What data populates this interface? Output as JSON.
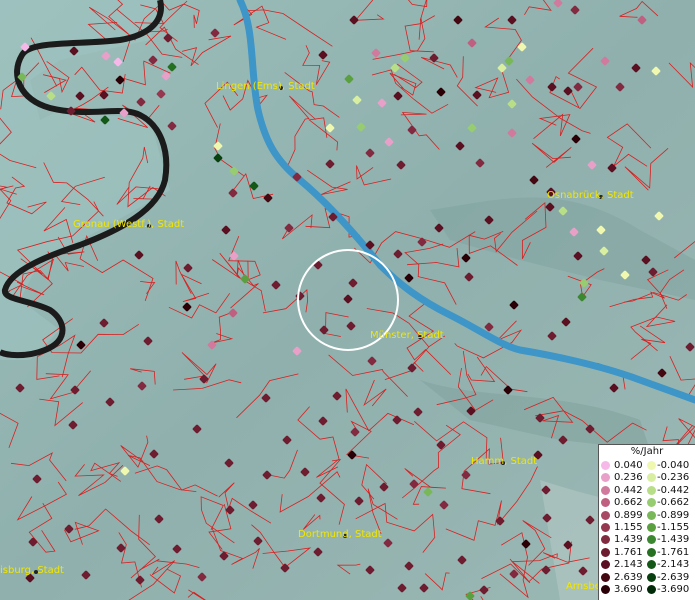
{
  "legend": {
    "title": "%/Jahr",
    "positive_labels": [
      "0.040",
      "0.236",
      "0.442",
      "0.662",
      "0.899",
      "1.155",
      "1.439",
      "1.761",
      "2.143",
      "2.639",
      "3.690"
    ],
    "negative_labels": [
      "-0.040",
      "-0.236",
      "-0.442",
      "-0.662",
      "-0.899",
      "-1.155",
      "-1.439",
      "-1.761",
      "-2.143",
      "-2.639",
      "-3.690"
    ],
    "positive_colors": [
      "#f5b8e8",
      "#e8a0c8",
      "#d07a9e",
      "#c06080",
      "#a84a66",
      "#963850",
      "#822a40",
      "#6e1c30",
      "#5a1020",
      "#440812",
      "#2a0006"
    ],
    "negative_colors": [
      "#f0f8b0",
      "#d8eea0",
      "#b8de88",
      "#98cc70",
      "#78b858",
      "#5aa040",
      "#3c8830",
      "#267022",
      "#145818",
      "#084010",
      "#002a08"
    ]
  },
  "cities": [
    {
      "name": "Lingen (Ems), Stadt"
    },
    {
      "name": "Osnabrück, Stadt"
    },
    {
      "name": "Gronau (Westf.), Stadt"
    },
    {
      "name": "Münster, Stadt"
    },
    {
      "name": "Hamm, Stadt"
    },
    {
      "name": "Dortmund, Stadt"
    },
    {
      "name": "isburg, Stadt"
    },
    {
      "name": "Arnsberg"
    }
  ]
}
